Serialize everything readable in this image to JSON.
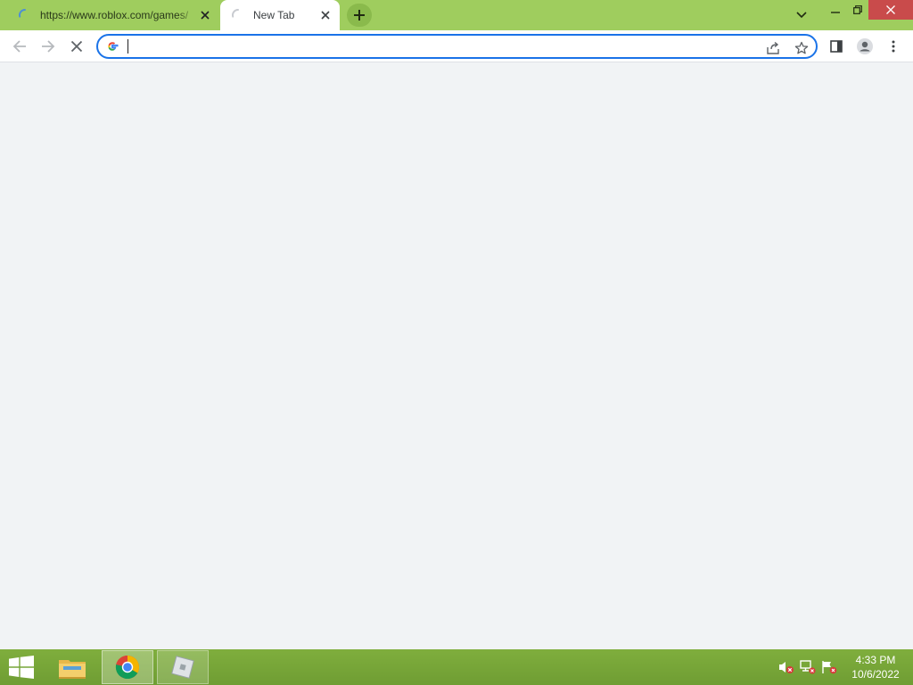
{
  "browser": {
    "tabs": [
      {
        "title": "https://www.roblox.com/games/",
        "state": "loading",
        "active": false
      },
      {
        "title": "New Tab",
        "state": "loading",
        "active": true
      }
    ],
    "omnibox": {
      "value": "",
      "search_engine_icon": "google-g-icon"
    },
    "colors": {
      "frame": "#9fcd5e",
      "focus_ring": "#1a73e8",
      "close_hover": "#c94b4b",
      "page_background": "#f1f3f5"
    }
  },
  "taskbar": {
    "pinned": [
      "file-explorer-icon",
      "chrome-icon",
      "roblox-icon"
    ],
    "tray": [
      "volume-muted-icon",
      "network-error-icon",
      "action-center-flag-icon"
    ],
    "clock": {
      "time": "4:33 PM",
      "date": "10/6/2022"
    },
    "color": "#7aa83a"
  }
}
